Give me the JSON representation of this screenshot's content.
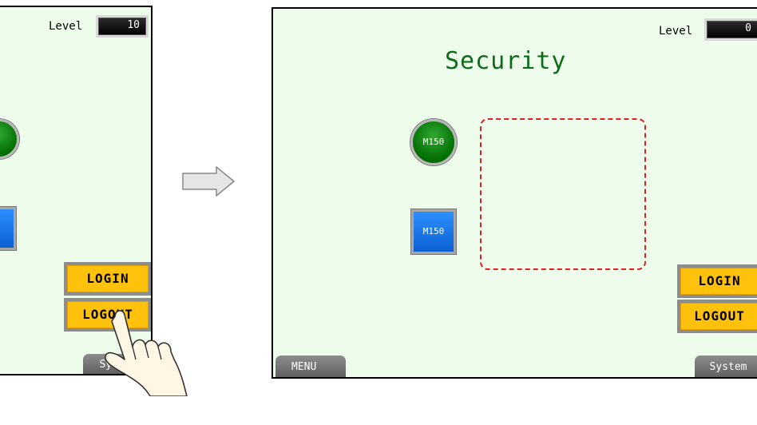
{
  "before": {
    "level_label": "Level",
    "level_value": "10",
    "login_label": "LOGIN",
    "logout_label": "LOGOUT",
    "system_label": "System"
  },
  "after": {
    "title": "Security",
    "level_label": "Level",
    "level_value": "0",
    "lamp_label": "M150",
    "switch_label": "M150",
    "login_label": "LOGIN",
    "logout_label": "LOGOUT",
    "menu_label": "MENU",
    "system_label": "System"
  },
  "colors": {
    "screen_bg": "#eefcec",
    "title": "#0d6b1a",
    "yellow_button": "#ffc20c",
    "lamp_green": "#008000",
    "switch_blue": "#1a75e8",
    "hidden_area_border": "#e02020"
  },
  "icons": {
    "transition": "arrow-right-icon",
    "gesture": "pointing-hand-icon"
  }
}
